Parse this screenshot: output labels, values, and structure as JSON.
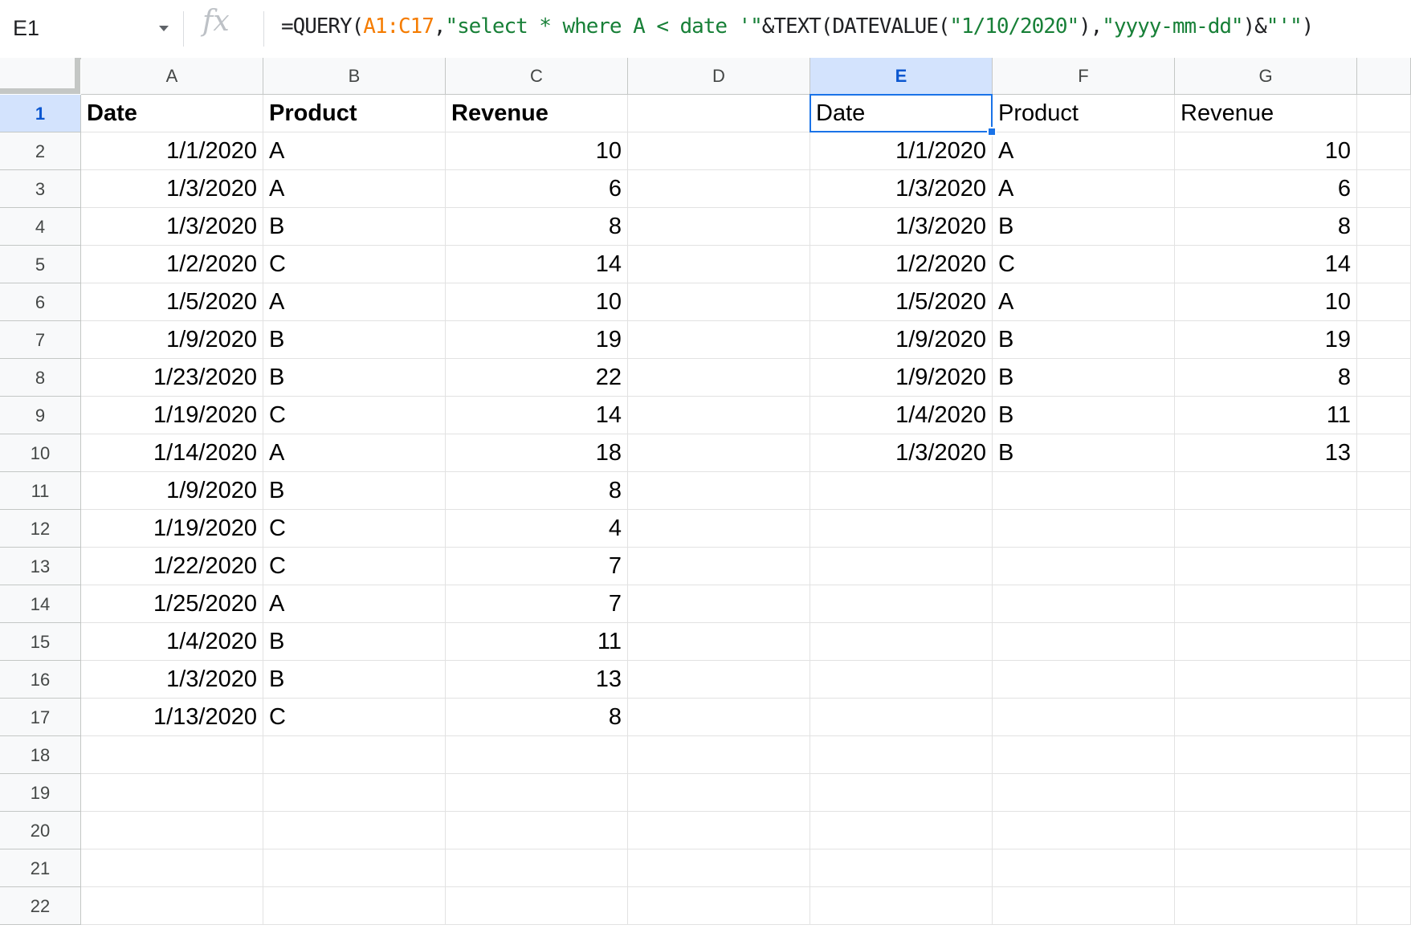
{
  "formula_bar": {
    "name_box": "E1",
    "fx_label": "fx",
    "formula_parts": [
      {
        "text": "=QUERY(",
        "color": "default"
      },
      {
        "text": "A1:C17",
        "color": "orange"
      },
      {
        "text": ",",
        "color": "default"
      },
      {
        "text": "\"select * where A < date '\"",
        "color": "green"
      },
      {
        "text": "&TEXT(DATEVALUE(",
        "color": "default"
      },
      {
        "text": "\"1/10/2020\"",
        "color": "green"
      },
      {
        "text": "),",
        "color": "default"
      },
      {
        "text": "\"yyyy-mm-dd\"",
        "color": "green"
      },
      {
        "text": ")&",
        "color": "default"
      },
      {
        "text": "\"'\"",
        "color": "green"
      },
      {
        "text": ")",
        "color": "default"
      }
    ]
  },
  "columns": [
    "A",
    "B",
    "C",
    "D",
    "E",
    "F",
    "G"
  ],
  "selected_column": "E",
  "row_numbers": [
    "1",
    "2",
    "3",
    "4",
    "5",
    "6",
    "7",
    "8",
    "9",
    "10",
    "11",
    "12",
    "13",
    "14",
    "15",
    "16",
    "17",
    "18",
    "19",
    "20",
    "21",
    "22"
  ],
  "selected_row": "1",
  "source_table": {
    "headers": [
      "Date",
      "Product",
      "Revenue"
    ],
    "rows": [
      [
        "1/1/2020",
        "A",
        "10"
      ],
      [
        "1/3/2020",
        "A",
        "6"
      ],
      [
        "1/3/2020",
        "B",
        "8"
      ],
      [
        "1/2/2020",
        "C",
        "14"
      ],
      [
        "1/5/2020",
        "A",
        "10"
      ],
      [
        "1/9/2020",
        "B",
        "19"
      ],
      [
        "1/23/2020",
        "B",
        "22"
      ],
      [
        "1/19/2020",
        "C",
        "14"
      ],
      [
        "1/14/2020",
        "A",
        "18"
      ],
      [
        "1/9/2020",
        "B",
        "8"
      ],
      [
        "1/19/2020",
        "C",
        "4"
      ],
      [
        "1/22/2020",
        "C",
        "7"
      ],
      [
        "1/25/2020",
        "A",
        "7"
      ],
      [
        "1/4/2020",
        "B",
        "11"
      ],
      [
        "1/3/2020",
        "B",
        "13"
      ],
      [
        "1/13/2020",
        "C",
        "8"
      ]
    ]
  },
  "result_table": {
    "headers": [
      "Date",
      "Product",
      "Revenue"
    ],
    "rows": [
      [
        "1/1/2020",
        "A",
        "10"
      ],
      [
        "1/3/2020",
        "A",
        "6"
      ],
      [
        "1/3/2020",
        "B",
        "8"
      ],
      [
        "1/2/2020",
        "C",
        "14"
      ],
      [
        "1/5/2020",
        "A",
        "10"
      ],
      [
        "1/9/2020",
        "B",
        "19"
      ],
      [
        "1/9/2020",
        "B",
        "8"
      ],
      [
        "1/4/2020",
        "B",
        "11"
      ],
      [
        "1/3/2020",
        "B",
        "13"
      ]
    ]
  },
  "colors": {
    "selection": "#1a73e8",
    "header_bg": "#f8f9fa",
    "selected_header_bg": "#d3e3fd",
    "formula_range": "#f57c00",
    "formula_string": "#188038"
  }
}
